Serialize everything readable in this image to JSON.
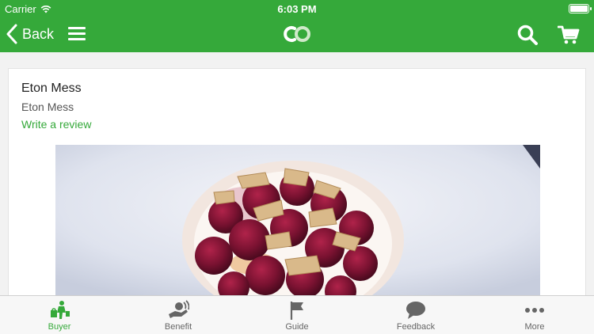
{
  "status_bar": {
    "carrier": "Carrier",
    "time": "6:03 PM"
  },
  "nav": {
    "back_label": "Back",
    "accent_color": "#35a93a",
    "icons": [
      "chevron-left-icon",
      "hamburger-menu-icon",
      "app-logo",
      "search-icon",
      "cart-icon"
    ]
  },
  "product": {
    "title": "Eton Mess",
    "subtitle": "Eton Mess",
    "review_link": "Write a review"
  },
  "tabs": [
    {
      "label": "Buyer",
      "icon": "buyer-icon",
      "active": true
    },
    {
      "label": "Benefit",
      "icon": "benefit-icon",
      "active": false
    },
    {
      "label": "Guide",
      "icon": "flag-icon",
      "active": false
    },
    {
      "label": "Feedback",
      "icon": "chat-bubble-icon",
      "active": false
    },
    {
      "label": "More",
      "icon": "more-dots-icon",
      "active": false
    }
  ]
}
